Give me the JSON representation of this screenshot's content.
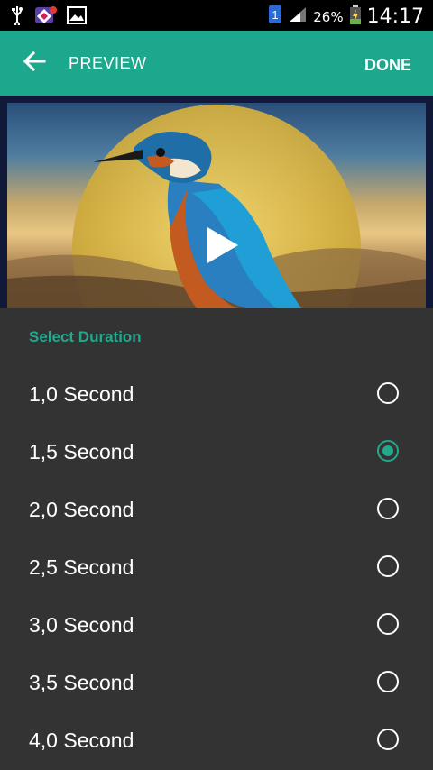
{
  "status_bar": {
    "battery_percent": "26%",
    "time": "14:17",
    "sim_badge": "1"
  },
  "app_bar": {
    "title": "PREVIEW",
    "done_label": "DONE"
  },
  "preview": {
    "play_icon": "play-icon"
  },
  "duration": {
    "section_title": "Select Duration",
    "options": [
      {
        "label": "1,0 Second",
        "selected": false
      },
      {
        "label": "1,5 Second",
        "selected": true
      },
      {
        "label": "2,0 Second",
        "selected": false
      },
      {
        "label": "2,5 Second",
        "selected": false
      },
      {
        "label": "3,0 Second",
        "selected": false
      },
      {
        "label": "3,5 Second",
        "selected": false
      },
      {
        "label": "4,0 Second",
        "selected": false
      }
    ]
  },
  "colors": {
    "accent": "#1ba88d",
    "panel_bg": "#333333"
  }
}
